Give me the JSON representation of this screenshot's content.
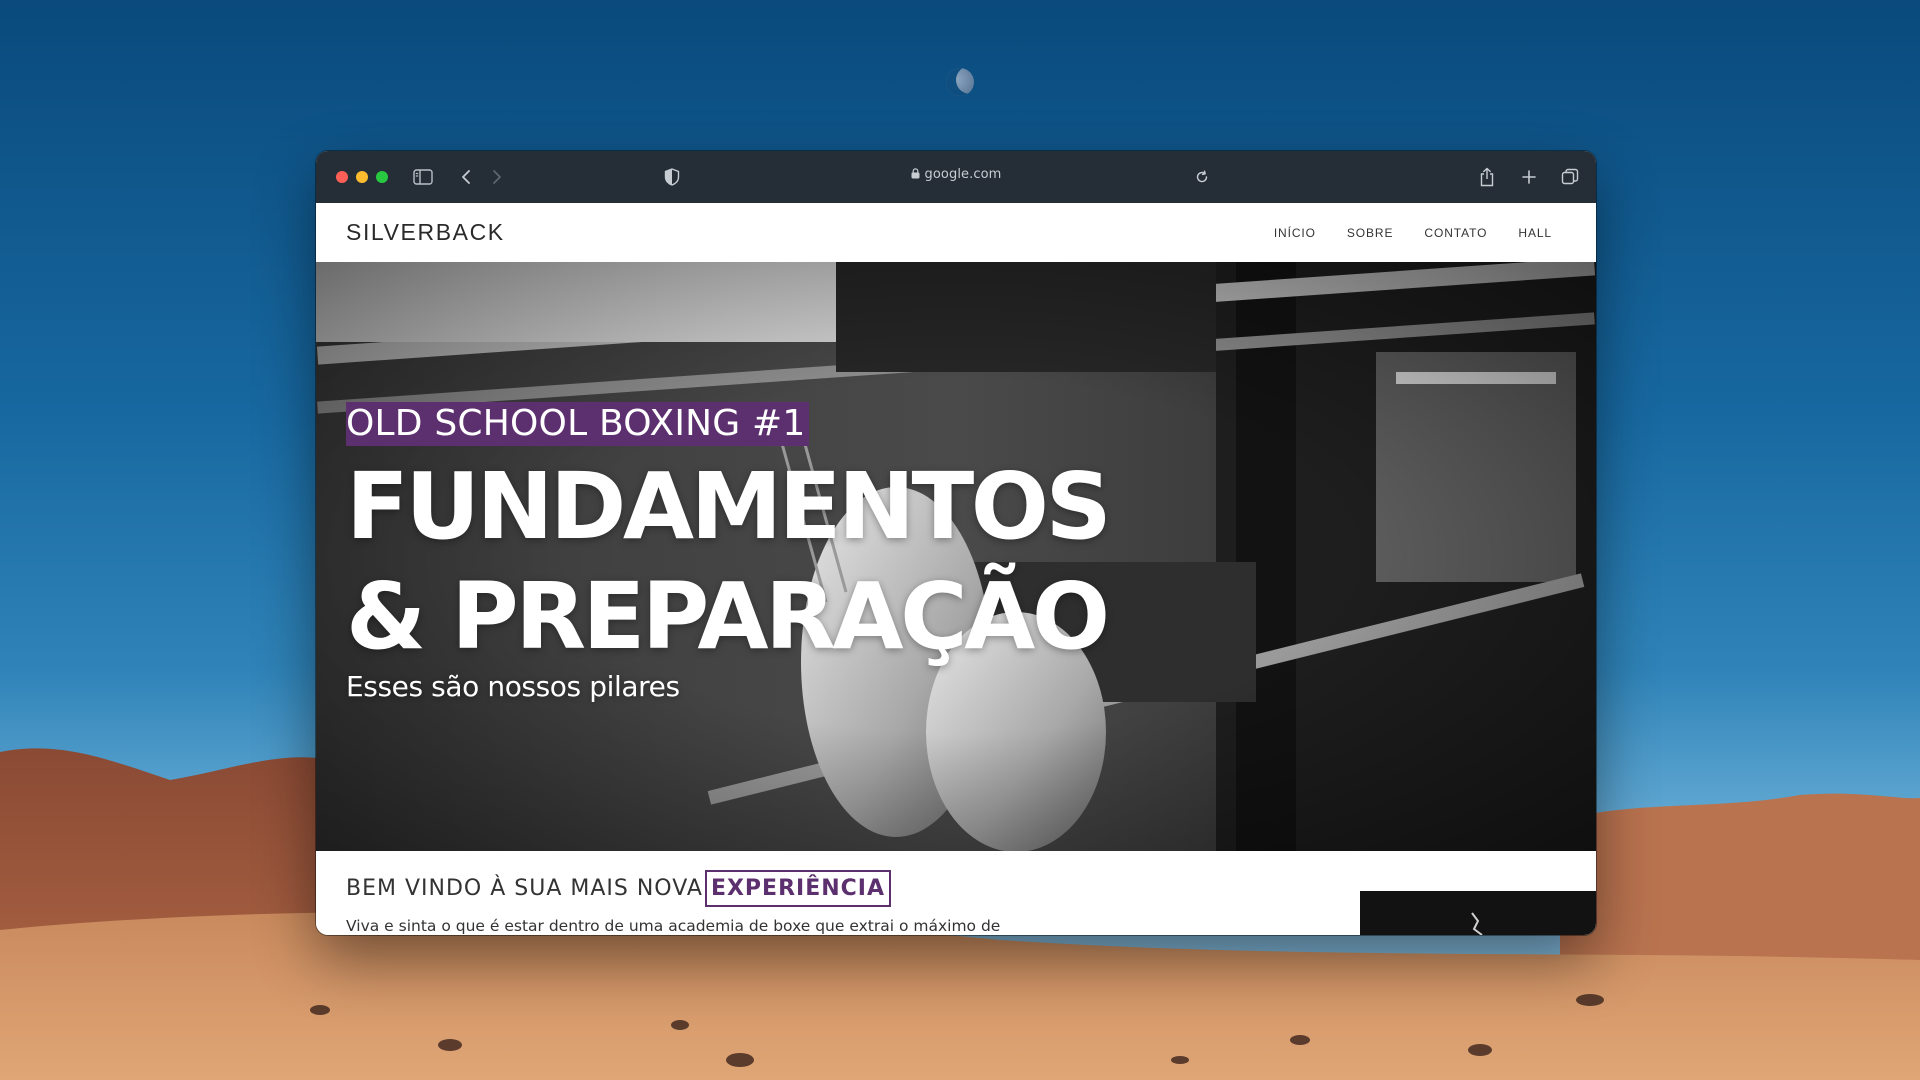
{
  "browser": {
    "url": "google.com"
  },
  "site": {
    "logo": "SILVERBACK",
    "nav": [
      "INÍCIO",
      "SOBRE",
      "CONTATO",
      "HALL"
    ]
  },
  "hero": {
    "eyebrow": "OLD SCHOOL BOXING #1",
    "headline_line1": "FUNDAMENTOS",
    "headline_line2": "& PREPARAÇÃO",
    "subline": "Esses são nossos pilares"
  },
  "welcome": {
    "title": "BEM VINDO À SUA MAIS NOVA",
    "accent": "EXPERIÊNCIA",
    "intro": "Viva e sinta o que é estar dentro de uma academia de boxe que extrai o máximo de"
  },
  "colors": {
    "accent": "#5c2f6f",
    "titlebar": "#252e37"
  }
}
